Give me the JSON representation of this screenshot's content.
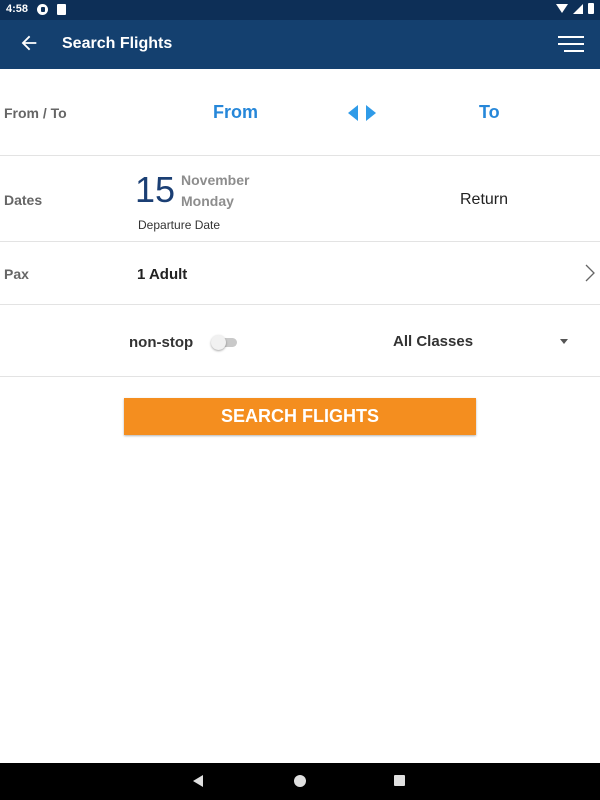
{
  "status_bar": {
    "time": "4:58",
    "icons": [
      "notification-icon",
      "sim-card-icon",
      "wifi-icon",
      "signal-icon",
      "battery-icon"
    ]
  },
  "app_bar": {
    "title": "Search Flights",
    "left_icon": "arrow-back-icon",
    "right_icon": "hamburger-menu-icon"
  },
  "route": {
    "label": "From / To",
    "from": "From",
    "to": "To",
    "swap_icon": "swap-arrows-icon"
  },
  "dates": {
    "label": "Dates",
    "departure_day": "15",
    "departure_month": "November",
    "departure_weekday": "Monday",
    "departure_caption": "Departure Date",
    "return": "Return"
  },
  "pax": {
    "label": "Pax",
    "value": "1 Adult"
  },
  "options": {
    "nonstop_label": "non-stop",
    "nonstop_enabled": false,
    "class_value": "All Classes"
  },
  "search_button": "SEARCH FLIGHTS",
  "colors": {
    "app_bar": "#14406f",
    "status_bar": "#0d2f57",
    "accent_blue": "#2687d9",
    "search_orange": "#f48e1f",
    "date_navy": "#1b3f74"
  }
}
